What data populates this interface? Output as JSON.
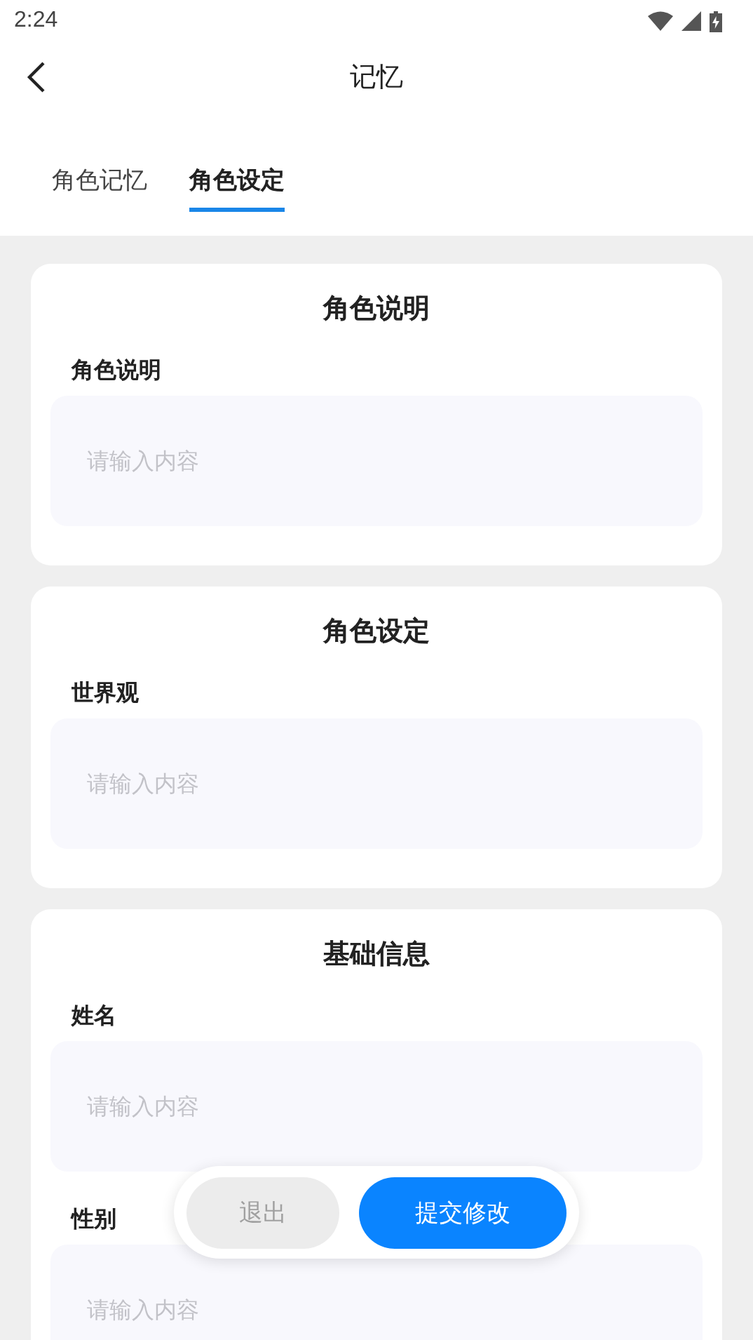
{
  "status_bar": {
    "time": "2:24"
  },
  "header": {
    "title": "记忆"
  },
  "tabs": [
    {
      "label": "角色记忆",
      "selected": false
    },
    {
      "label": "角色设定",
      "selected": true
    }
  ],
  "cards": [
    {
      "title": "角色说明",
      "fields": [
        {
          "label": "角色说明",
          "placeholder": "请输入内容"
        }
      ]
    },
    {
      "title": "角色设定",
      "fields": [
        {
          "label": "世界观",
          "placeholder": "请输入内容"
        }
      ]
    },
    {
      "title": "基础信息",
      "fields": [
        {
          "label": "姓名",
          "placeholder": "请输入内容"
        },
        {
          "label": "性别",
          "placeholder": "请输入内容"
        }
      ]
    }
  ],
  "actions": [
    {
      "label": "退出",
      "kind": "secondary"
    },
    {
      "label": "提交修改",
      "kind": "primary"
    }
  ]
}
